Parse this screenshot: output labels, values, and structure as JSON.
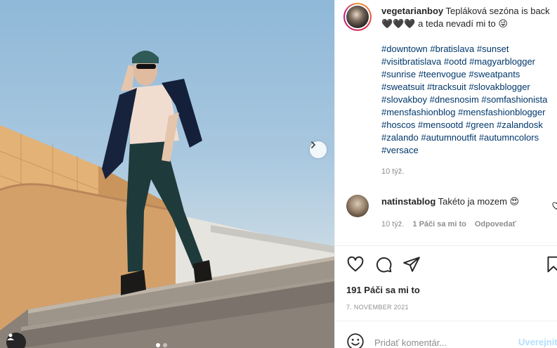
{
  "post": {
    "username": "vegetarianboy",
    "caption_line1": " Tepláková sezóna is back",
    "caption_line2": "🖤🖤🖤 a teda nevadí mi to 😜",
    "hashtag_lines": [
      [
        "#downtown",
        "#bratislava",
        "#sunset"
      ],
      [
        "#visitbratislava",
        "#ootd",
        "#magyarblogger"
      ],
      [
        "#sunrise",
        "#teenvogue",
        "#sweatpants"
      ],
      [
        "#sweatsuit",
        "#tracksuit",
        "#slovakblogger"
      ],
      [
        "#slovakboy",
        "#dnesnosim",
        "#somfashionista"
      ],
      [
        "#mensfashionblog",
        "#mensfashionblogger"
      ],
      [
        "#hoscos",
        "#mensootd",
        "#green",
        "#zalandosk"
      ],
      [
        "#zalando",
        "#autumnoutfit",
        "#autumncolors"
      ],
      [
        "#versace"
      ]
    ],
    "time_ago": "10 týž.",
    "likes": "191 Páči sa mi to",
    "date": "7. NOVEMBER 2021"
  },
  "comment": {
    "username": "natinstablog",
    "text": "Takéto ja mozem 😍",
    "time_ago": "10 týž.",
    "likes": "1 Páči sa mi to",
    "reply_label": "Odpovedať"
  },
  "comment_form": {
    "placeholder": "Pridať komentár...",
    "post_label": "Uverejniť"
  },
  "icons": {
    "photo_next": "chevron-right-icon",
    "photo_tags": "user-tag-icon",
    "like": "heart-icon",
    "comment": "comment-bubble-icon",
    "share": "paper-plane-icon",
    "save": "bookmark-icon",
    "emoji": "smiley-icon"
  },
  "colors": {
    "hashtag": "#00376b",
    "muted": "#8e8e8e",
    "post_button_disabled": "#b2dffc"
  }
}
